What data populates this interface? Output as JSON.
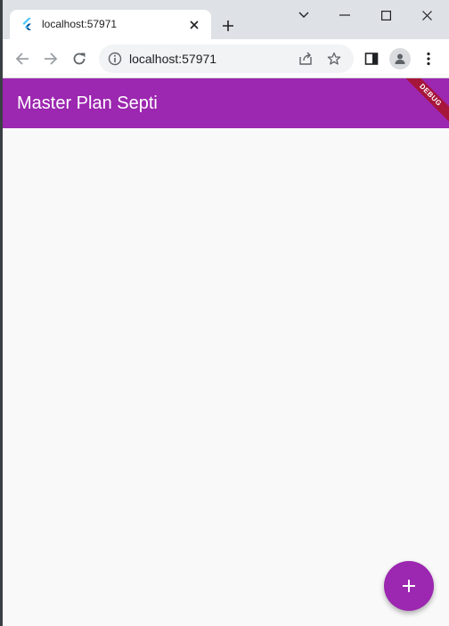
{
  "browser": {
    "tab": {
      "title": "localhost:57971"
    },
    "address_bar": {
      "url": "localhost:57971"
    }
  },
  "app": {
    "title": "Master Plan Septi",
    "debug_banner": "DEBUG",
    "accent_color": "#9c27b0"
  },
  "fab": {
    "icon": "add-icon"
  }
}
